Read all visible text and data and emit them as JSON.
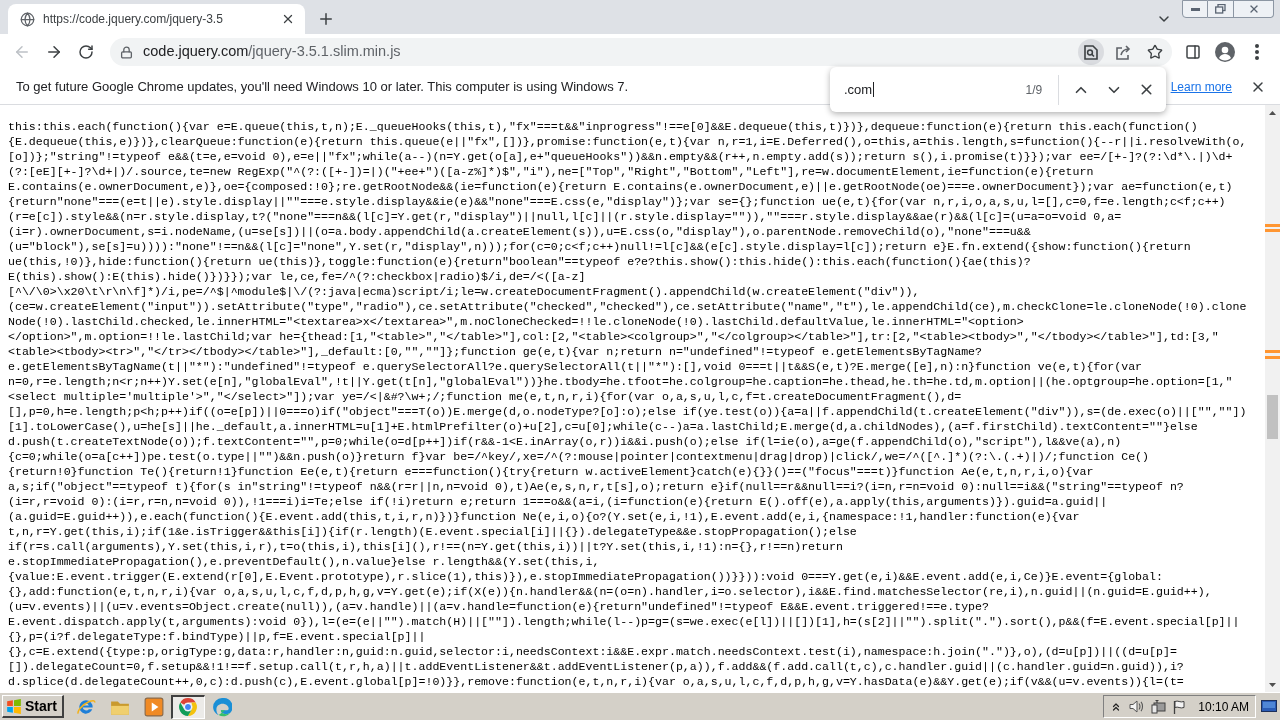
{
  "tab_strip": {
    "tabs": [
      {
        "title": "https://code.jquery.com/jquery-3.5",
        "selected": true
      }
    ]
  },
  "toolbar": {
    "back": {
      "disabled": true
    },
    "forward": {
      "disabled": false
    },
    "address": {
      "host": "code.jquery.com",
      "path": "/jquery-3.5.1.slim.min.js"
    },
    "find_in_page": {
      "selected": true
    }
  },
  "infobar": {
    "message": "To get future Google Chrome updates, you'll need Windows 10 or later. This computer is using Windows 7.",
    "link": "Learn more"
  },
  "find_bar": {
    "query": ".com",
    "count": "1/9"
  },
  "code_lines": [
    "this:this.each(function(){var e=E.queue(this,t,n);E._queueHooks(this,t),\"fx\"===t&&\"inprogress\"!==e[0]&&E.dequeue(this,t)})},dequeue:function(e){return this.each(function()",
    "{E.dequeue(this,e)})},clearQueue:function(e){return this.queue(e||\"fx\",[])},promise:function(e,t){var n,r=1,i=E.Deferred(),o=this,a=this.length,s=function(){--r||i.resolveWith(o,",
    "[o])};\"string\"!=typeof e&&(t=e,e=void 0),e=e||\"fx\";while(a--)(n=Y.get(o[a],e+\"queueHooks\"))&&n.empty&&(r++,n.empty.add(s));return s(),i.promise(t)}});var ee=/[+-]?(?:\\d*\\.|)\\d+",
    "(?:[eE][+-]?\\d+|)/.source,te=new RegExp(\"^(?:([+-])=|)(\"+ee+\")([a-z%]*)$\",\"i\"),ne=[\"Top\",\"Right\",\"Bottom\",\"Left\"],re=w.documentElement,ie=function(e){return",
    "E.contains(e.ownerDocument,e)},oe={composed:!0};re.getRootNode&&(ie=function(e){return E.contains(e.ownerDocument,e)||e.getRootNode(oe)===e.ownerDocument});var ae=function(e,t)",
    "{return\"none\"===(e=t||e).style.display||\"\"===e.style.display&&ie(e)&&\"none\"===E.css(e,\"display\")};var se={};function ue(e,t){for(var n,r,i,o,a,s,u,l=[],c=0,f=e.length;c<f;c++)",
    "(r=e[c]).style&&(n=r.style.display,t?(\"none\"===n&&(l[c]=Y.get(r,\"display\")||null,l[c]||(r.style.display=\"\")),\"\"===r.style.display&&ae(r)&&(l[c]=(u=a=o=void 0,a=",
    "(i=r).ownerDocument,s=i.nodeName,(u=se[s])||(o=a.body.appendChild(a.createElement(s)),u=E.css(o,\"display\"),o.parentNode.removeChild(o),\"none\"===u&&",
    "(u=\"block\"),se[s]=u)))):\"none\"!==n&&(l[c]=\"none\",Y.set(r,\"display\",n)));for(c=0;c<f;c++)null!=l[c]&&(e[c].style.display=l[c]);return e}E.fn.extend({show:function(){return",
    "ue(this,!0)},hide:function(){return ue(this)},toggle:function(e){return\"boolean\"==typeof e?e?this.show():this.hide():this.each(function(){ae(this)?",
    "E(this).show():E(this).hide()})}});var le,ce,fe=/^(?:checkbox|radio)$/i,de=/<([a-z]",
    "[^\\/\\0>\\x20\\t\\r\\n\\f]*)/i,pe=/^$|^module$|\\/(?:java|ecma)script/i;le=w.createDocumentFragment().appendChild(w.createElement(\"div\")),",
    "(ce=w.createElement(\"input\")).setAttribute(\"type\",\"radio\"),ce.setAttribute(\"checked\",\"checked\"),ce.setAttribute(\"name\",\"t\"),le.appendChild(ce),m.checkClone=le.cloneNode(!0).clone",
    "Node(!0).lastChild.checked,le.innerHTML=\"<textarea>x</textarea>\",m.noCloneChecked=!!le.cloneNode(!0).lastChild.defaultValue,le.innerHTML=\"<option>",
    "</option>\",m.option=!!le.lastChild;var he={thead:[1,\"<table>\",\"</table>\"],col:[2,\"<table><colgroup>\",\"</colgroup></table>\"],tr:[2,\"<table><tbody>\",\"</tbody></table>\"],td:[3,\"",
    "<table><tbody><tr>\",\"</tr></tbody></table>\"],_default:[0,\"\",\"\"]};function ge(e,t){var n;return n=\"undefined\"!=typeof e.getElementsByTagName?",
    "e.getElementsByTagName(t||\"*\"):\"undefined\"!=typeof e.querySelectorAll?e.querySelectorAll(t||\"*\"):[],void 0===t||t&&S(e,t)?E.merge([e],n):n}function ve(e,t){for(var",
    "n=0,r=e.length;n<r;n++)Y.set(e[n],\"globalEval\",!t||Y.get(t[n],\"globalEval\"))}he.tbody=he.tfoot=he.colgroup=he.caption=he.thead,he.th=he.td,m.option||(he.optgroup=he.option=[1,\"",
    "<select multiple='multiple'>\",\"</select>\"]);var ye=/<|&#?\\w+;/;function me(e,t,n,r,i){for(var o,a,s,u,l,c,f=t.createDocumentFragment(),d=",
    "[],p=0,h=e.length;p<h;p++)if((o=e[p])||0===o)if(\"object\"===T(o))E.merge(d,o.nodeType?[o]:o);else if(ye.test(o)){a=a||f.appendChild(t.createElement(\"div\")),s=(de.exec(o)||[\"\",\"\"])",
    "[1].toLowerCase(),u=he[s]||he._default,a.innerHTML=u[1]+E.htmlPrefilter(o)+u[2],c=u[0];while(c--)a=a.lastChild;E.merge(d,a.childNodes),(a=f.firstChild).textContent=\"\"}else",
    "d.push(t.createTextNode(o));f.textContent=\"\",p=0;while(o=d[p++])if(r&&-1<E.inArray(o,r))i&&i.push(o);else if(l=ie(o),a=ge(f.appendChild(o),\"script\"),l&&ve(a),n)",
    "{c=0;while(o=a[c++])pe.test(o.type||\"\")&&n.push(o)}return f}var be=/^key/,xe=/^(?:mouse|pointer|contextmenu|drag|drop)|click/,we=/^([^.]*)(?:\\.(.+)|)/;function Ce()",
    "{return!0}function Te(){return!1}function Ee(e,t){return e===function(){try{return w.activeElement}catch(e){}}()==(\"focus\"===t)}function Ae(e,t,n,r,i,o){var",
    "a,s;if(\"object\"==typeof t){for(s in\"string\"!=typeof n&&(r=r||n,n=void 0),t)Ae(e,s,n,r,t[s],o);return e}if(null==r&&null==i?(i=n,r=n=void 0):null==i&&(\"string\"==typeof n?",
    "(i=r,r=void 0):(i=r,r=n,n=void 0)),!1===i)i=Te;else if(!i)return e;return 1===o&&(a=i,(i=function(e){return E().off(e),a.apply(this,arguments)}).guid=a.guid||",
    "(a.guid=E.guid++)),e.each(function(){E.event.add(this,t,i,r,n)})}function Ne(e,i,o){o?(Y.set(e,i,!1),E.event.add(e,i,{namespace:!1,handler:function(e){var",
    "t,n,r=Y.get(this,i);if(1&e.isTrigger&&this[i]){if(r.length)(E.event.special[i]||{}).delegateType&&e.stopPropagation();else",
    "if(r=s.call(arguments),Y.set(this,i,r),t=o(this,i),this[i](),r!==(n=Y.get(this,i))||t?Y.set(this,i,!1):n={},r!==n)return",
    "e.stopImmediatePropagation(),e.preventDefault(),n.value}else r.length&&(Y.set(this,i,",
    "{value:E.event.trigger(E.extend(r[0],E.Event.prototype),r.slice(1),this)}),e.stopImmediatePropagation())}})):void 0===Y.get(e,i)&&E.event.add(e,i,Ce)}E.event={global:",
    "{},add:function(e,t,n,r,i){var o,a,s,u,l,c,f,d,p,h,g,v=Y.get(e);if(X(e)){n.handler&&(n=(o=n).handler,i=o.selector),i&&E.find.matchesSelector(re,i),n.guid||(n.guid=E.guid++),",
    "(u=v.events)||(u=v.events=Object.create(null)),(a=v.handle)||(a=v.handle=function(e){return\"undefined\"!=typeof E&&E.event.triggered!==e.type?",
    "E.event.dispatch.apply(t,arguments):void 0}),l=(e=(e||\"\").match(H)||[\"\"]).length;while(l--)p=g=(s=we.exec(e[l])||[])[1],h=(s[2]||\"\").split(\".\").sort(),p&&(f=E.event.special[p]||",
    "{},p=(i?f.delegateType:f.bindType)||p,f=E.event.special[p]||",
    "{},c=E.extend({type:p,origType:g,data:r,handler:n,guid:n.guid,selector:i,needsContext:i&&E.expr.match.needsContext.test(i),namespace:h.join(\".\")},o),(d=u[p])||((d=u[p]=",
    "[]).delegateCount=0,f.setup&&!1!==f.setup.call(t,r,h,a)||t.addEventListener&&t.addEventListener(p,a)),f.add&&(f.add.call(t,c),c.handler.guid||(c.handler.guid=n.guid)),i?",
    "d.splice(d.delegateCount++,0,c):d.push(c),E.event.global[p]=!0)}},remove:function(e,t,n,r,i){var o,a,s,u,l,c,f,d,p,h,g,v=Y.hasData(e)&&Y.get(e);if(v&&(u=v.events)){l=(t="
  ],
  "taskbar": {
    "start": "Start",
    "apps": [
      {
        "kind": "ie",
        "selected": false
      },
      {
        "kind": "folder",
        "selected": false
      },
      {
        "kind": "media",
        "selected": false
      },
      {
        "kind": "chrome",
        "selected": true
      },
      {
        "kind": "edge",
        "selected": false
      }
    ],
    "clock": "10:10 AM"
  }
}
